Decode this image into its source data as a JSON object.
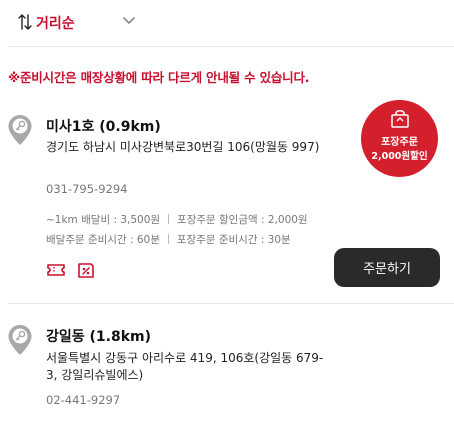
{
  "sort": {
    "label": "거리순",
    "sort_icon": "sort-arrows-icon",
    "dropdown_icon": "chevron-down-icon"
  },
  "notice": "※준비시간은 매장상황에 따라 다르게 안내될 수 있습니다.",
  "badge": {
    "line1": "포장주문",
    "line2": "2,000원할인",
    "icon": "takeout-bag-icon"
  },
  "stores": [
    {
      "name": "미사1호 (0.9km)",
      "address": "경기도 하남시 미사강변북로30번길 106(망월동 997)",
      "phone": "031-795-9294",
      "delivery_fee": "~1km 배달비 : 3,500원",
      "pickup_discount": "포장주문 할인금액 : 2,000원",
      "delivery_time": "배달주문 준비시간 : 60분",
      "pickup_time": "포장주문 준비시간 : 30분",
      "feature_icons": [
        "coupon-icon",
        "discount-tag-icon"
      ],
      "order_label": "주문하기"
    },
    {
      "name": "강일동 (1.8km)",
      "address": "서울특별시 강동구 아리수로 419, 106호(강일동 679-3, 강일리슈빌에스)",
      "phone": "02-441-9297"
    }
  ],
  "colors": {
    "accent": "#c8102e",
    "badge": "#d4202c",
    "button": "#2a2a2a",
    "pin": "#a8a8a8"
  }
}
